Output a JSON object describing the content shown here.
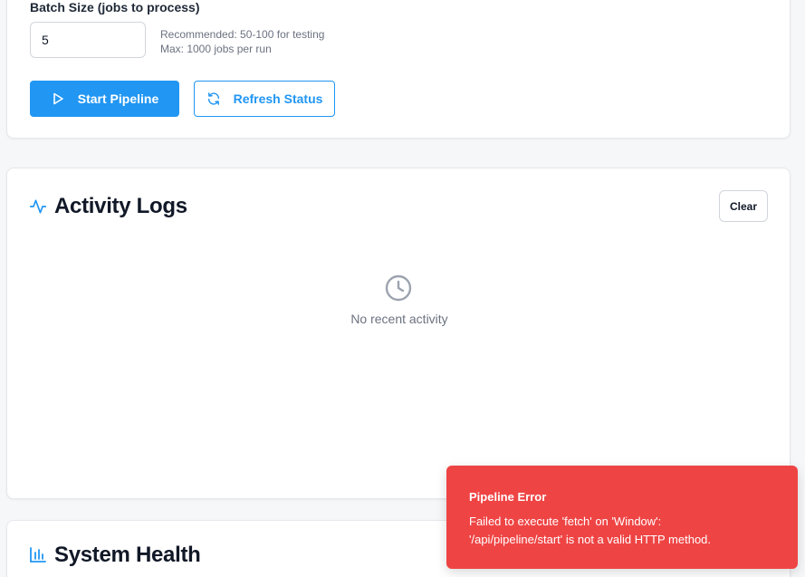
{
  "pipeline": {
    "batch_label": "Batch Size (jobs to process)",
    "batch_value": "5",
    "hint_recommended": "Recommended: 50-100 for testing",
    "hint_max": "Max: 1000 jobs per run",
    "start_label": "Start Pipeline",
    "refresh_label": "Refresh Status",
    "start_icon": "play-icon",
    "refresh_icon": "refresh-icon"
  },
  "logs": {
    "title": "Activity Logs",
    "title_icon": "activity-icon",
    "clear_label": "Clear",
    "empty_icon": "clock-icon",
    "empty_text": "No recent activity"
  },
  "health": {
    "title": "System Health",
    "title_icon": "bar-chart-icon"
  },
  "toast": {
    "title": "Pipeline Error",
    "message": "Failed to execute 'fetch' on 'Window':\n'/api/pipeline/start' is not a valid HTTP method.",
    "color": "#ef4444"
  },
  "colors": {
    "accent": "#2196f3",
    "background": "#f6f7f9",
    "card": "#ffffff"
  }
}
